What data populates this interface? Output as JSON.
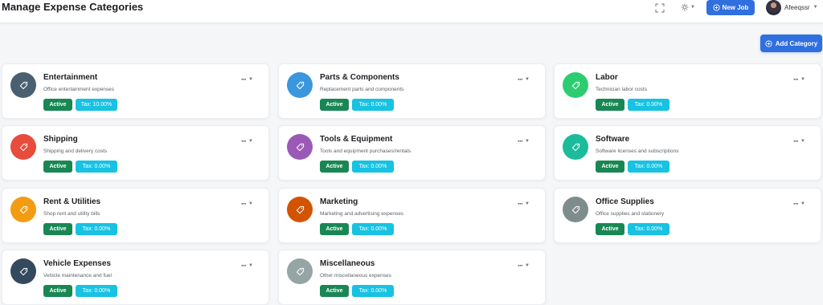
{
  "header": {
    "title": "Manage Expense Categories",
    "new_job_label": "New Job",
    "user_name": "Afeeqssr"
  },
  "actions": {
    "add_category_label": "Add Category"
  },
  "categories": [
    {
      "name": "Entertainment",
      "description": "Office entertainment expenses",
      "status": "Active",
      "tax": "Tax: 10.00%",
      "color": "#4a6070"
    },
    {
      "name": "Parts & Components",
      "description": "Replacement parts and components",
      "status": "Active",
      "tax": "Tax: 0.00%",
      "color": "#3b97dd"
    },
    {
      "name": "Labor",
      "description": "Technician labor costs",
      "status": "Active",
      "tax": "Tax: 0.00%",
      "color": "#2ecc71"
    },
    {
      "name": "Shipping",
      "description": "Shipping and delivery costs",
      "status": "Active",
      "tax": "Tax: 0.00%",
      "color": "#e74c3c"
    },
    {
      "name": "Tools & Equipment",
      "description": "Tools and equipment purchases/rentals",
      "status": "Active",
      "tax": "Tax: 0.00%",
      "color": "#9b59b6"
    },
    {
      "name": "Software",
      "description": "Software licenses and subscriptions",
      "status": "Active",
      "tax": "Tax: 0.00%",
      "color": "#1abc9c"
    },
    {
      "name": "Rent & Utilities",
      "description": "Shop rent and utility bills",
      "status": "Active",
      "tax": "Tax: 0.00%",
      "color": "#f39c12"
    },
    {
      "name": "Marketing",
      "description": "Marketing and advertising expenses",
      "status": "Active",
      "tax": "Tax: 0.00%",
      "color": "#d35400"
    },
    {
      "name": "Office Supplies",
      "description": "Office supplies and stationery",
      "status": "Active",
      "tax": "Tax: 0.00%",
      "color": "#7f8c8d"
    },
    {
      "name": "Vehicle Expenses",
      "description": "Vehicle maintenance and fuel",
      "status": "Active",
      "tax": "Tax: 0.00%",
      "color": "#34495e"
    },
    {
      "name": "Miscellaneous",
      "description": "Other miscellaneous expenses",
      "status": "Active",
      "tax": "Tax: 0.00%",
      "color": "#95a5a6"
    }
  ],
  "icons": {
    "fullscreen": "fullscreen-icon",
    "theme": "sun-icon",
    "new_job": "plus-circle-icon",
    "add_category": "plus-circle-icon",
    "category": "tag-icon",
    "card_menu": "more-horizontal-icon"
  },
  "colors": {
    "primary": "#2f6fe0",
    "active_badge": "#198754",
    "tax_badge": "#17c2e3"
  }
}
